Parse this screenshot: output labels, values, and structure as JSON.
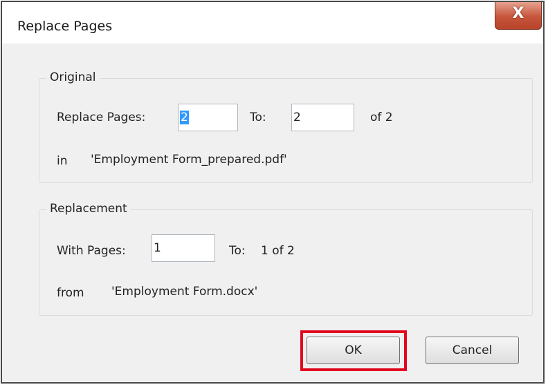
{
  "window": {
    "title": "Replace Pages",
    "close_glyph": "X"
  },
  "original": {
    "group_label": "Original",
    "replace_pages_label": "Replace Pages:",
    "from_value": "2",
    "to_label": "To:",
    "to_value": "2",
    "of_text": "of 2",
    "in_label": "in",
    "in_file": "'Employment Form_prepared.pdf'"
  },
  "replacement": {
    "group_label": "Replacement",
    "with_pages_label": "With Pages:",
    "with_value": "1",
    "to_label": "To:",
    "to_text": "1 of 2",
    "from_label": "from",
    "from_file": "'Employment Form.docx'"
  },
  "buttons": {
    "ok": "OK",
    "cancel": "Cancel"
  },
  "colors": {
    "highlight": "#e1061e",
    "close": "#c6553b",
    "selection": "#3399ff"
  },
  "icons": {
    "close": "close-icon"
  }
}
